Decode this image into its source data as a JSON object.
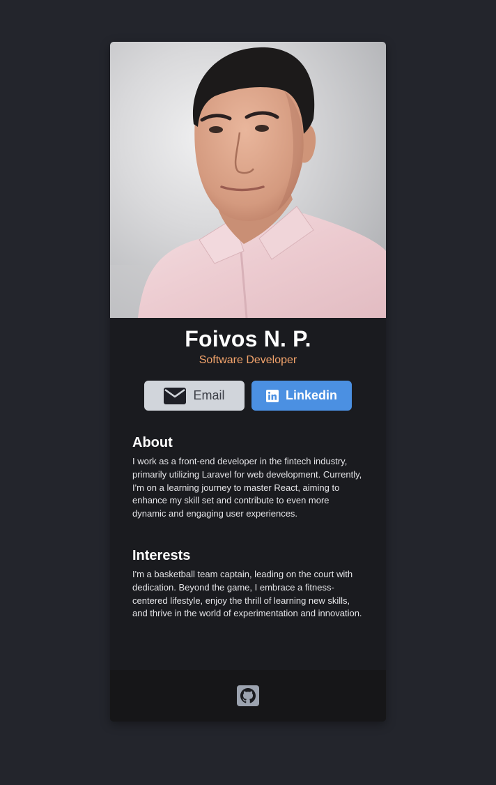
{
  "profile": {
    "name": "Foivos N. P.",
    "role": "Software Developer"
  },
  "buttons": {
    "email_label": "Email",
    "email_icon": "envelope-icon",
    "linkedin_label": "Linkedin",
    "linkedin_icon": "linkedin-icon"
  },
  "about": {
    "heading": "About",
    "text": "I work as a front-end developer in the fintech industry, primarily utilizing Laravel for web development. Currently, I'm on a learning journey to master React, aiming to enhance my skill set and contribute to even more dynamic and engaging user experiences."
  },
  "interests": {
    "heading": "Interests",
    "text": "I'm a basketball team captain, leading on the court with dedication. Beyond the game, I embrace a fitness-centered lifestyle, enjoy the thrill of learning new skills, and thrive in the world of experimentation and innovation."
  },
  "footer": {
    "icon": "github-icon"
  },
  "colors": {
    "page_background": "#23252c",
    "card_background": "#1a1b1f",
    "footer_background": "#161618",
    "role_accent": "#f3a46c",
    "email_button": "#d1d5db",
    "linkedin_button": "#4b90e2"
  }
}
